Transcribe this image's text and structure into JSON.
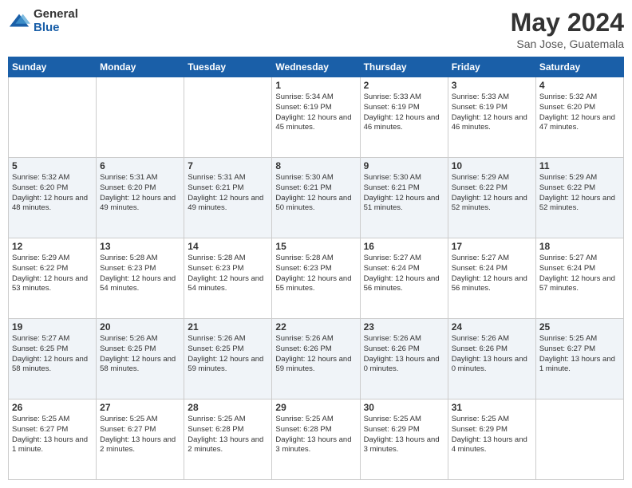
{
  "logo": {
    "general": "General",
    "blue": "Blue"
  },
  "header": {
    "month": "May 2024",
    "location": "San Jose, Guatemala"
  },
  "days_of_week": [
    "Sunday",
    "Monday",
    "Tuesday",
    "Wednesday",
    "Thursday",
    "Friday",
    "Saturday"
  ],
  "weeks": [
    [
      {
        "day": "",
        "info": ""
      },
      {
        "day": "",
        "info": ""
      },
      {
        "day": "",
        "info": ""
      },
      {
        "day": "1",
        "info": "Sunrise: 5:34 AM\nSunset: 6:19 PM\nDaylight: 12 hours\nand 45 minutes."
      },
      {
        "day": "2",
        "info": "Sunrise: 5:33 AM\nSunset: 6:19 PM\nDaylight: 12 hours\nand 46 minutes."
      },
      {
        "day": "3",
        "info": "Sunrise: 5:33 AM\nSunset: 6:19 PM\nDaylight: 12 hours\nand 46 minutes."
      },
      {
        "day": "4",
        "info": "Sunrise: 5:32 AM\nSunset: 6:20 PM\nDaylight: 12 hours\nand 47 minutes."
      }
    ],
    [
      {
        "day": "5",
        "info": "Sunrise: 5:32 AM\nSunset: 6:20 PM\nDaylight: 12 hours\nand 48 minutes."
      },
      {
        "day": "6",
        "info": "Sunrise: 5:31 AM\nSunset: 6:20 PM\nDaylight: 12 hours\nand 49 minutes."
      },
      {
        "day": "7",
        "info": "Sunrise: 5:31 AM\nSunset: 6:21 PM\nDaylight: 12 hours\nand 49 minutes."
      },
      {
        "day": "8",
        "info": "Sunrise: 5:30 AM\nSunset: 6:21 PM\nDaylight: 12 hours\nand 50 minutes."
      },
      {
        "day": "9",
        "info": "Sunrise: 5:30 AM\nSunset: 6:21 PM\nDaylight: 12 hours\nand 51 minutes."
      },
      {
        "day": "10",
        "info": "Sunrise: 5:29 AM\nSunset: 6:22 PM\nDaylight: 12 hours\nand 52 minutes."
      },
      {
        "day": "11",
        "info": "Sunrise: 5:29 AM\nSunset: 6:22 PM\nDaylight: 12 hours\nand 52 minutes."
      }
    ],
    [
      {
        "day": "12",
        "info": "Sunrise: 5:29 AM\nSunset: 6:22 PM\nDaylight: 12 hours\nand 53 minutes."
      },
      {
        "day": "13",
        "info": "Sunrise: 5:28 AM\nSunset: 6:23 PM\nDaylight: 12 hours\nand 54 minutes."
      },
      {
        "day": "14",
        "info": "Sunrise: 5:28 AM\nSunset: 6:23 PM\nDaylight: 12 hours\nand 54 minutes."
      },
      {
        "day": "15",
        "info": "Sunrise: 5:28 AM\nSunset: 6:23 PM\nDaylight: 12 hours\nand 55 minutes."
      },
      {
        "day": "16",
        "info": "Sunrise: 5:27 AM\nSunset: 6:24 PM\nDaylight: 12 hours\nand 56 minutes."
      },
      {
        "day": "17",
        "info": "Sunrise: 5:27 AM\nSunset: 6:24 PM\nDaylight: 12 hours\nand 56 minutes."
      },
      {
        "day": "18",
        "info": "Sunrise: 5:27 AM\nSunset: 6:24 PM\nDaylight: 12 hours\nand 57 minutes."
      }
    ],
    [
      {
        "day": "19",
        "info": "Sunrise: 5:27 AM\nSunset: 6:25 PM\nDaylight: 12 hours\nand 58 minutes."
      },
      {
        "day": "20",
        "info": "Sunrise: 5:26 AM\nSunset: 6:25 PM\nDaylight: 12 hours\nand 58 minutes."
      },
      {
        "day": "21",
        "info": "Sunrise: 5:26 AM\nSunset: 6:25 PM\nDaylight: 12 hours\nand 59 minutes."
      },
      {
        "day": "22",
        "info": "Sunrise: 5:26 AM\nSunset: 6:26 PM\nDaylight: 12 hours\nand 59 minutes."
      },
      {
        "day": "23",
        "info": "Sunrise: 5:26 AM\nSunset: 6:26 PM\nDaylight: 13 hours\nand 0 minutes."
      },
      {
        "day": "24",
        "info": "Sunrise: 5:26 AM\nSunset: 6:26 PM\nDaylight: 13 hours\nand 0 minutes."
      },
      {
        "day": "25",
        "info": "Sunrise: 5:25 AM\nSunset: 6:27 PM\nDaylight: 13 hours\nand 1 minute."
      }
    ],
    [
      {
        "day": "26",
        "info": "Sunrise: 5:25 AM\nSunset: 6:27 PM\nDaylight: 13 hours\nand 1 minute."
      },
      {
        "day": "27",
        "info": "Sunrise: 5:25 AM\nSunset: 6:27 PM\nDaylight: 13 hours\nand 2 minutes."
      },
      {
        "day": "28",
        "info": "Sunrise: 5:25 AM\nSunset: 6:28 PM\nDaylight: 13 hours\nand 2 minutes."
      },
      {
        "day": "29",
        "info": "Sunrise: 5:25 AM\nSunset: 6:28 PM\nDaylight: 13 hours\nand 3 minutes."
      },
      {
        "day": "30",
        "info": "Sunrise: 5:25 AM\nSunset: 6:29 PM\nDaylight: 13 hours\nand 3 minutes."
      },
      {
        "day": "31",
        "info": "Sunrise: 5:25 AM\nSunset: 6:29 PM\nDaylight: 13 hours\nand 4 minutes."
      },
      {
        "day": "",
        "info": ""
      }
    ]
  ]
}
